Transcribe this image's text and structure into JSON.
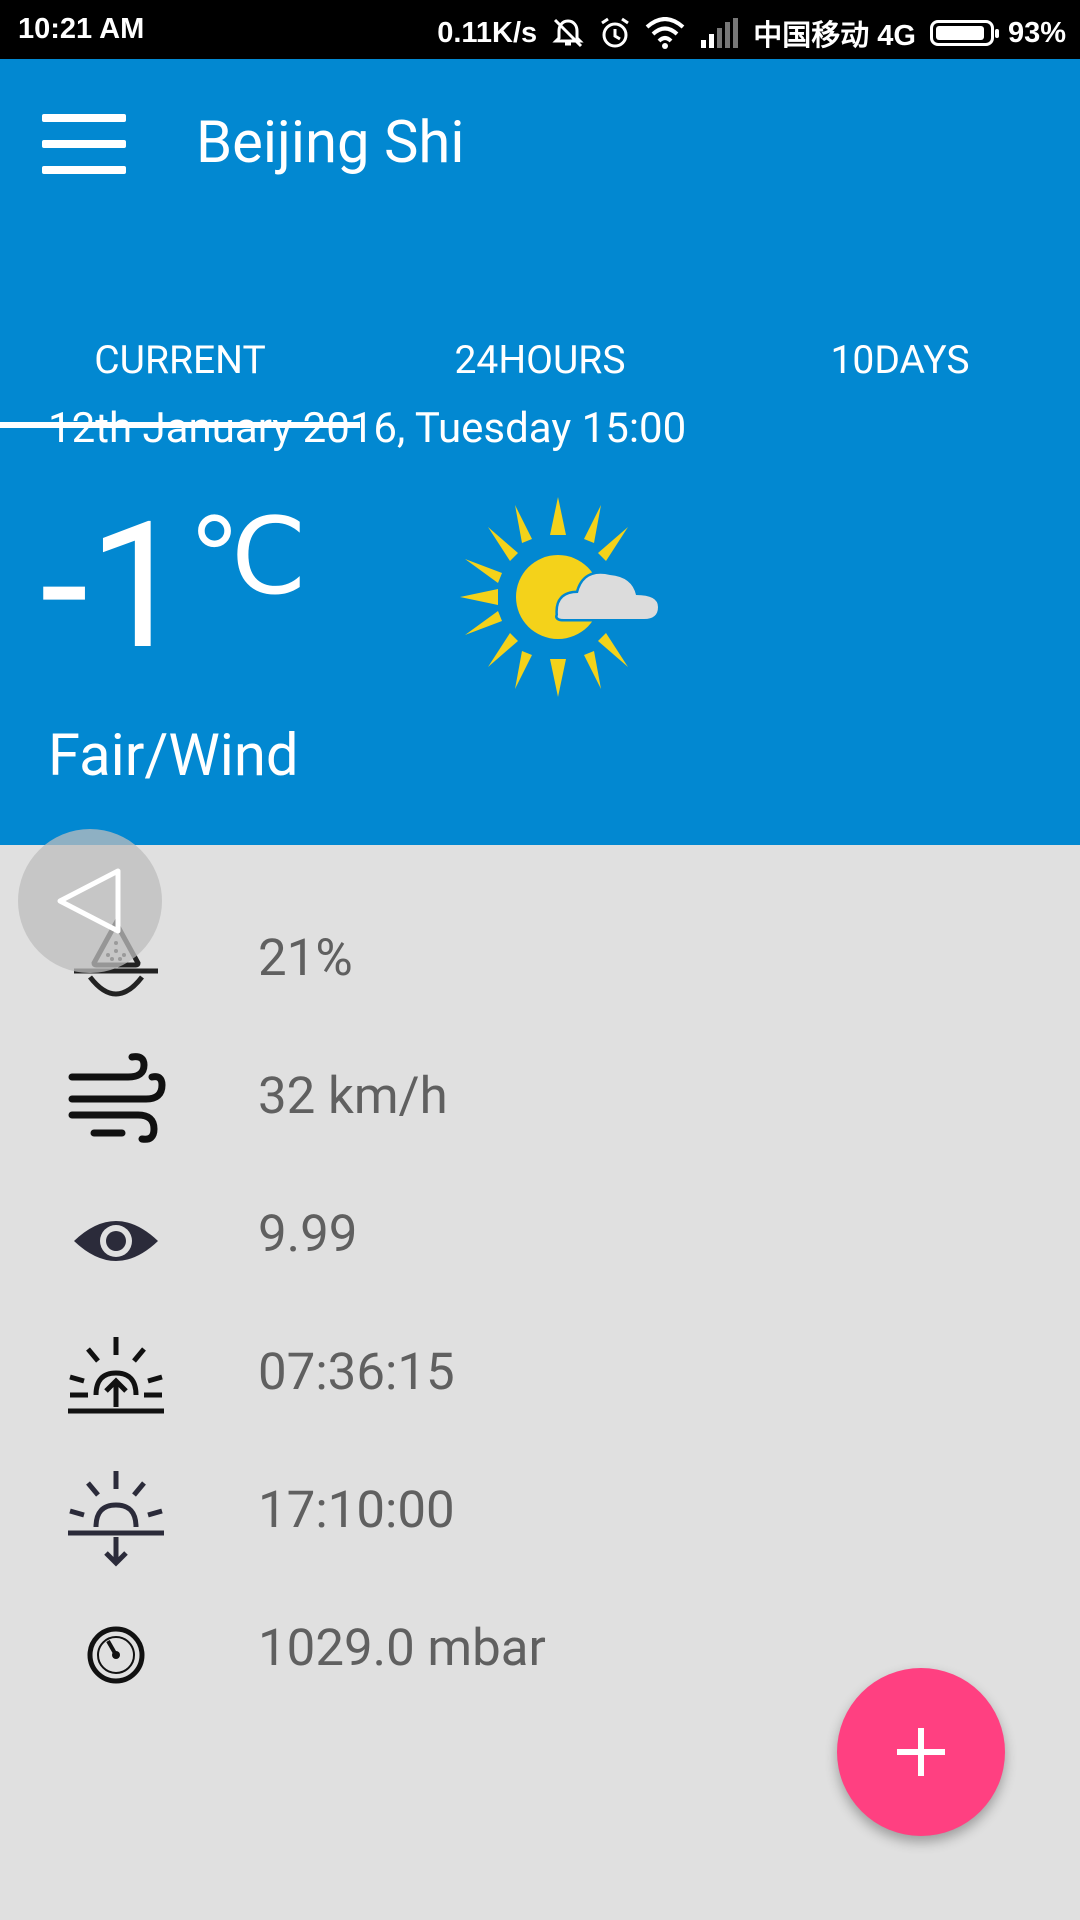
{
  "status_bar": {
    "time": "10:21 AM",
    "network_speed": "0.11K/s",
    "carrier": "中国移动 4G",
    "battery_percent": "93%",
    "battery_level": 0.93,
    "icons": [
      "mute-icon",
      "alarm-icon",
      "wifi-icon",
      "signal-icon",
      "battery-icon"
    ]
  },
  "app_bar": {
    "menu_icon": "hamburger-menu-icon",
    "title": "Beijing Shi",
    "background": "#0288d1"
  },
  "tabs": {
    "items": [
      {
        "label": "CURRENT",
        "selected": true
      },
      {
        "label": "24HOURS",
        "selected": false
      },
      {
        "label": "10DAYS",
        "selected": false
      }
    ]
  },
  "current": {
    "datetime": "12th January 2016, Tuesday 15:00",
    "temperature": "-1",
    "unit": "℃",
    "condition": "Fair/Wind",
    "condition_icon": "sun-cloud-icon"
  },
  "details": [
    {
      "icon": "humidity-icon",
      "value": "21%"
    },
    {
      "icon": "wind-icon",
      "value": "32 km/h"
    },
    {
      "icon": "visibility-eye-icon",
      "value": "9.99"
    },
    {
      "icon": "sunrise-icon",
      "value": "07:36:15"
    },
    {
      "icon": "sunset-icon",
      "value": "17:10:00"
    },
    {
      "icon": "pressure-gauge-icon",
      "value": "1029.0 mbar"
    }
  ],
  "fab": {
    "icon": "plus-icon",
    "color": "#ff4081"
  },
  "overlay": {
    "icon": "back-triangle-icon"
  }
}
